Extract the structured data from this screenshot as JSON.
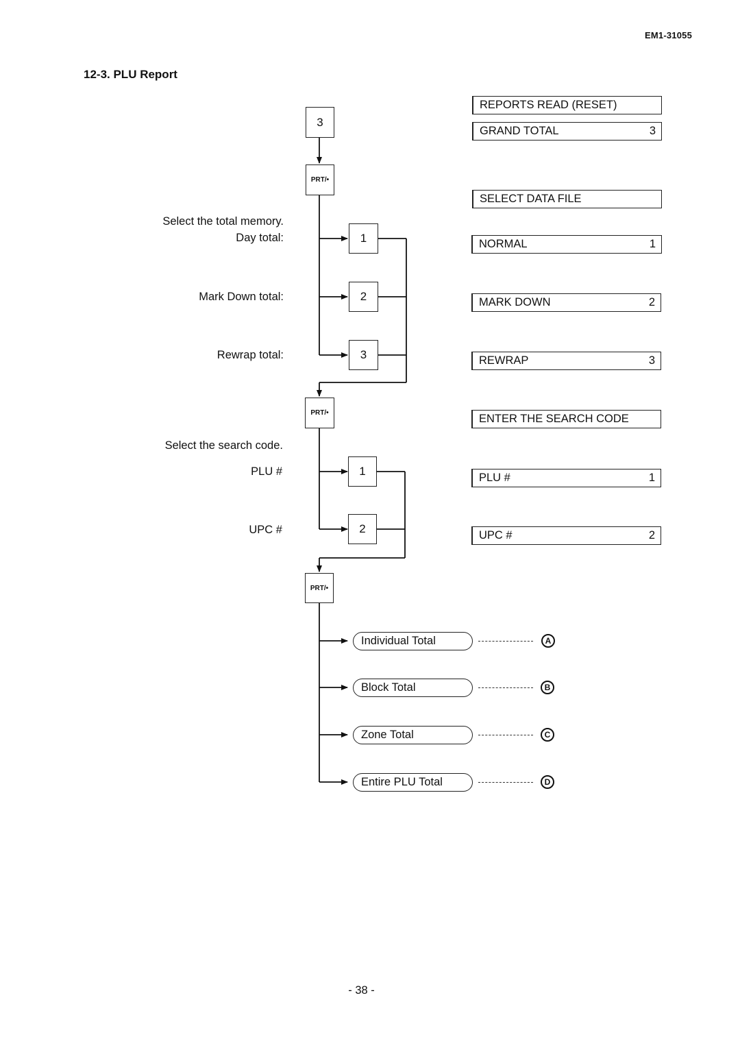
{
  "header": {
    "doc_number": "EM1-31055"
  },
  "section": {
    "title": "12-3. PLU Report"
  },
  "keys": {
    "start": "3",
    "prt": "PRT/•",
    "memory": [
      "1",
      "2",
      "3"
    ],
    "search": [
      "1",
      "2"
    ]
  },
  "labels": {
    "select_memory": "Select the total memory.",
    "memory": [
      "Day total:",
      "Mark Down total:",
      "Rewrap total:"
    ],
    "select_search": "Select the search code.",
    "search": [
      "PLU #",
      "UPC #"
    ]
  },
  "displays": {
    "reports_read": {
      "text": "REPORTS READ (RESET)",
      "value": ""
    },
    "grand_total": {
      "text": "GRAND TOTAL",
      "value": "3"
    },
    "select_data_file": {
      "text": "SELECT DATA FILE",
      "value": ""
    },
    "normal": {
      "text": "NORMAL",
      "value": "1"
    },
    "mark_down": {
      "text": "MARK DOWN",
      "value": "2"
    },
    "rewrap": {
      "text": "REWRAP",
      "value": "3"
    },
    "enter_search": {
      "text": "ENTER THE SEARCH CODE",
      "value": ""
    },
    "plu": {
      "text": "PLU #",
      "value": "1"
    },
    "upc": {
      "text": "UPC #",
      "value": "2"
    }
  },
  "options": [
    {
      "label": "Individual Total",
      "ref": "A"
    },
    {
      "label": "Block Total",
      "ref": "B"
    },
    {
      "label": "Zone Total",
      "ref": "C"
    },
    {
      "label": "Entire PLU Total",
      "ref": "D"
    }
  ],
  "footer": {
    "page": "- 38 -"
  }
}
